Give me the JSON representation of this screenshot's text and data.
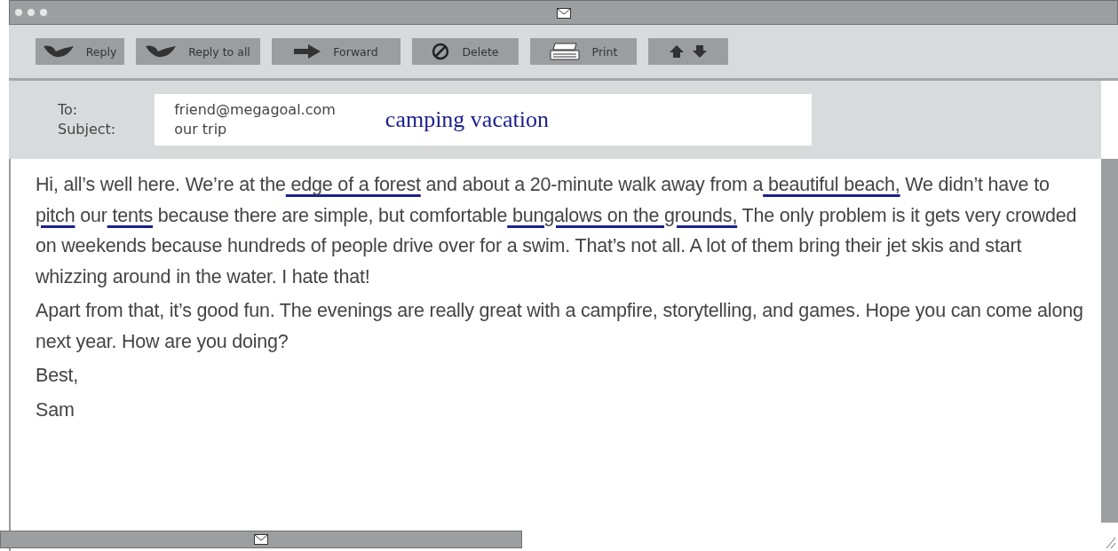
{
  "toolbar": [
    {
      "kind": "reply",
      "label": "Reply"
    },
    {
      "kind": "reply-all",
      "label": "Reply to all"
    },
    {
      "kind": "forward",
      "label": "Forward"
    },
    {
      "kind": "delete",
      "label": "Delete"
    },
    {
      "kind": "print",
      "label": "Print"
    },
    {
      "kind": "arrows"
    }
  ],
  "header": {
    "to_label": "To:",
    "to": "friend@megagoal.com",
    "subject_label": "Subject:",
    "subject": "our trip",
    "note": "camping vacation"
  },
  "body": [
    [
      {
        "text": "Hi, all’s well here. We’re at the",
        "underlined": false
      },
      {
        "text": " edge of a forest",
        "underlined": true
      },
      {
        "text": " and about a 20-minute walk away from a",
        "underlined": false
      },
      {
        "text": " beautiful beach,",
        "underlined": true
      },
      {
        "text": " We didn’t have to",
        "underlined": false
      },
      {
        "text": " pitch",
        "underlined": true
      },
      {
        "text": " our",
        "underlined": false
      },
      {
        "text": " tents",
        "underlined": true
      },
      {
        "text": " because there are simple, but comfortable",
        "underlined": false
      },
      {
        "text": " bungalows on the grounds,",
        "underlined": true
      },
      {
        "text": " The only problem is it gets very crowded on weekends because hundreds of people drive over for a swim. That’s not all. A lot of them bring their jet skis and start whizzing around in the water. I hate that!",
        "underlined": false
      }
    ],
    [
      {
        "text": "Apart from that, it’s good fun. The evenings are really great with a campfire, storytelling, and games. Hope you can come along next year. How are you doing?",
        "underlined": false
      }
    ],
    [
      {
        "text": "Best,",
        "underlined": false
      }
    ],
    [
      {
        "text": "Sam",
        "underlined": false
      }
    ]
  ]
}
